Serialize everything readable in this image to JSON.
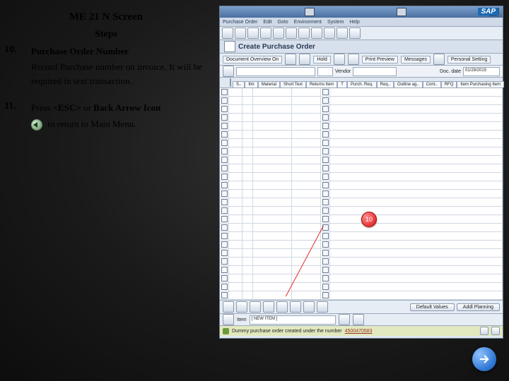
{
  "left": {
    "title": "ME 21 N Screen",
    "steps_heading": "Steps",
    "steps": [
      {
        "num": "10.",
        "title": "Purchase Order Number",
        "text": "Record Purchase number on invoice.  It will be required in text transaction."
      },
      {
        "num": "11.",
        "prefix": "Press ",
        "esc": "<ESC>",
        "or": " or ",
        "back_label": "Back Arrow Icon",
        "suffix": "to return to Main Menu."
      }
    ]
  },
  "sap": {
    "window_title": "",
    "logo": "SAP",
    "menu": [
      "Purchase Order",
      "Edit",
      "Goto",
      "Environment",
      "System",
      "Help"
    ],
    "page_title": "Create Purchase Order",
    "subtool": [
      "Document Overview On",
      "Hold",
      "Print Preview",
      "Messages",
      "Personal Setting"
    ],
    "form": {
      "vendor_label": "Vendor",
      "doc_date_label": "Doc. date",
      "doc_date_value": "01/29/2015"
    },
    "tabs": [
      "S..",
      "Itm",
      "Material",
      "Short Text",
      "Returns Item",
      "T",
      "Purch. Req.",
      "Req..",
      "Outline ag..",
      "Cont..",
      "RFQ",
      "Item  Purchasing  Item"
    ],
    "grid_rows": 26,
    "callout": "10",
    "footer_buttons": [
      "Default Values",
      "Addl Planning"
    ],
    "item_bar": {
      "label": "Item",
      "value": "[ NEW ITEM ]"
    },
    "status": {
      "prefix": "Dummy purchase order created under the number",
      "number": "4500470583"
    }
  }
}
